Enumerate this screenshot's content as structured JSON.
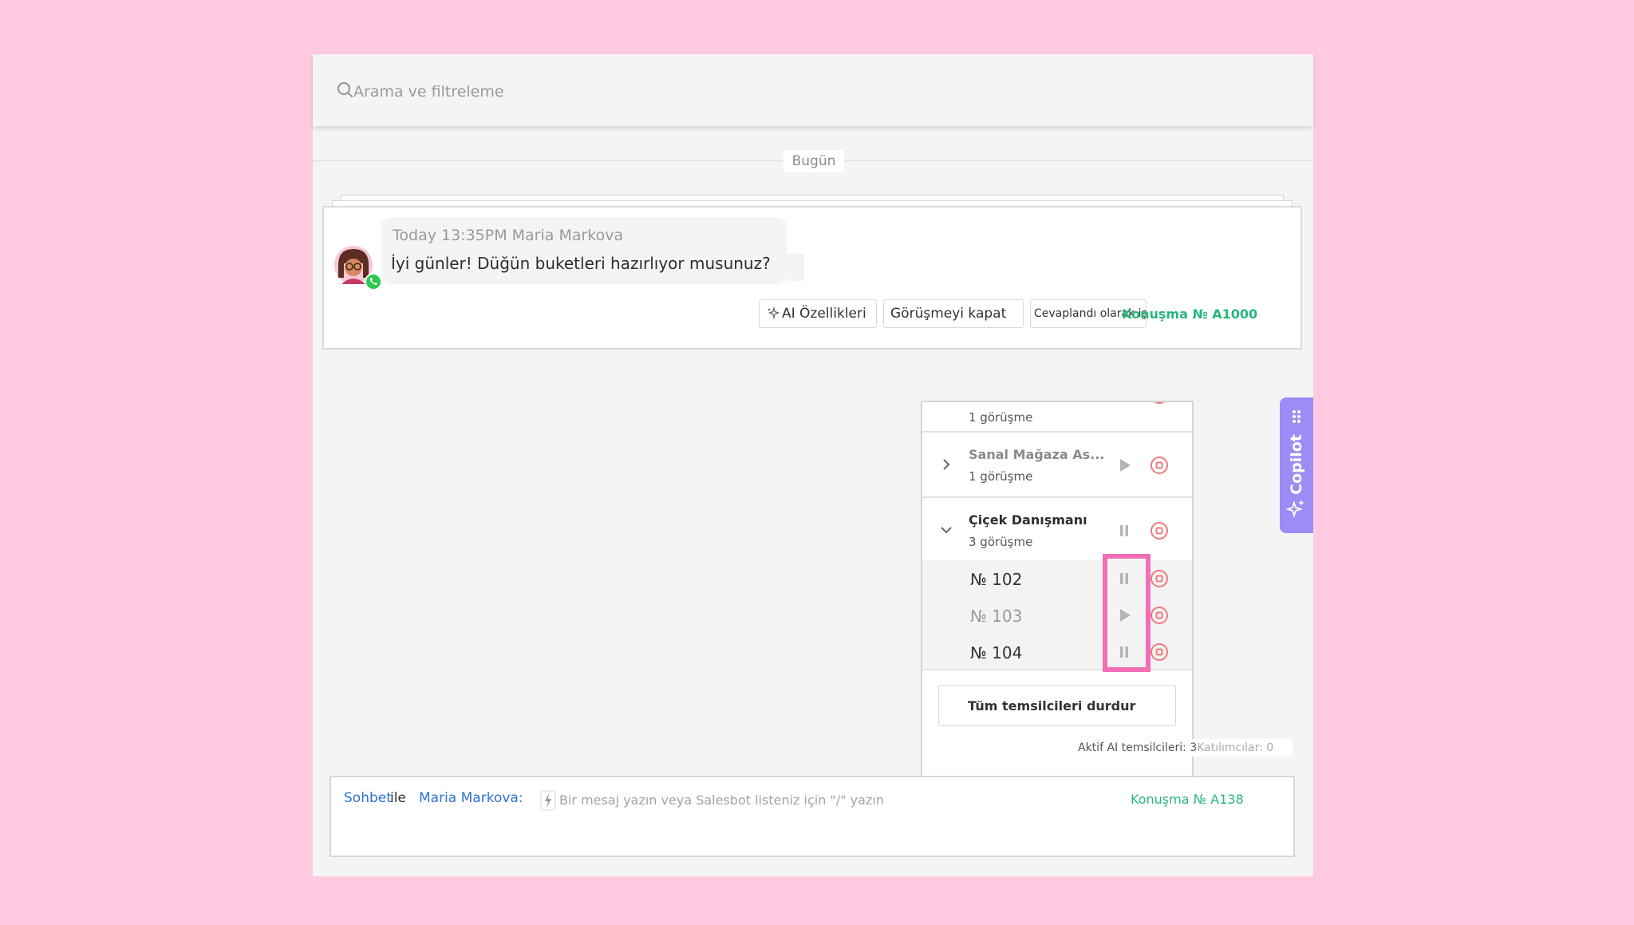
{
  "search": {
    "placeholder": "Arama ve filtreleme"
  },
  "feed": {
    "date_separator": "Bugün"
  },
  "message": {
    "meta": "Today 13:35PM Maria Markova",
    "text": "İyi günler! Düğün buketleri hazırlıyor musunuz?",
    "channel_icon": "whatsapp-icon"
  },
  "actions": {
    "ai_features": "AI Özellikleri",
    "close_conversation": "Görüşmeyi kapat",
    "mark_answered": "Cevaplandı olarak işa",
    "conversation_id": "Konuşma № A1000"
  },
  "agents_panel": {
    "groups": [
      {
        "name": "",
        "count": "1 görüşme"
      },
      {
        "name": "Sanal Mağaza As...",
        "count": "1 görüşme"
      },
      {
        "name": "Çiçek Danışmanı",
        "count": "3 görüşme"
      }
    ],
    "conversations": [
      {
        "label": "№ 102",
        "state": "running"
      },
      {
        "label": "№ 103",
        "state": "paused"
      },
      {
        "label": "№ 104",
        "state": "running"
      }
    ],
    "stop_all": "Tüm temsilcileri durdur"
  },
  "status": {
    "active_agents": "Aktif AI temsilcileri: 3",
    "participants": "Katılımcılar: 0"
  },
  "copilot": {
    "label": "Copilot"
  },
  "composer": {
    "chat_label": "Sohbet",
    "with_label": "ile",
    "recipient": "Maria Markova:",
    "placeholder": "Bir mesaj yazın veya Salesbot listeniz için \"/\" yazın",
    "conversation_id": "Konuşma № A138"
  },
  "colors": {
    "page_background": "#ffc9df",
    "link_blue": "#2c72d6",
    "accent_green": "#29b67e",
    "copilot_purple": "#9b8df5",
    "stop_red": "#f07a7a",
    "highlight_pink": "#f06fb6"
  }
}
